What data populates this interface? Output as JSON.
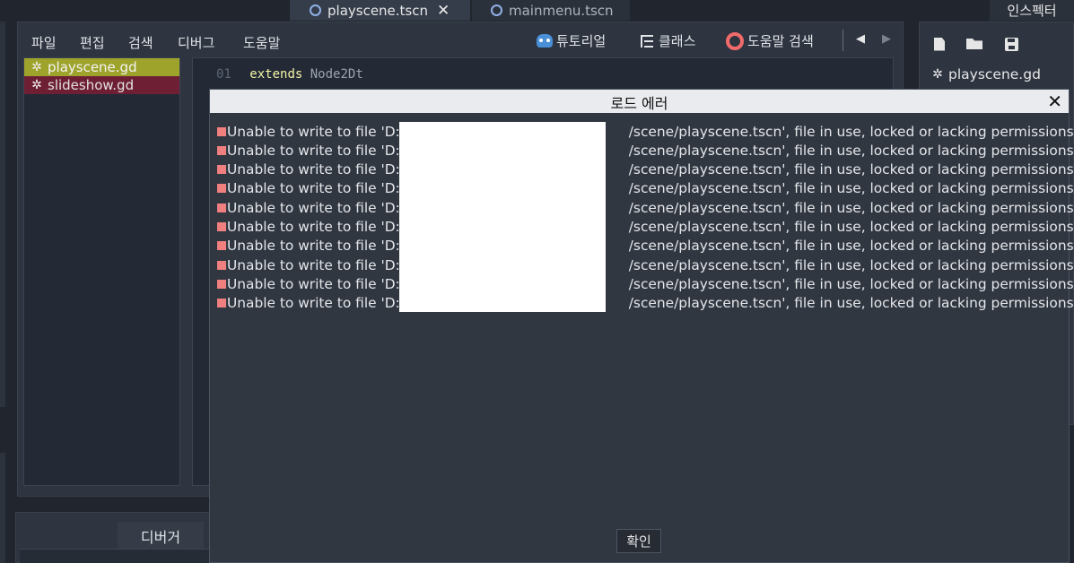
{
  "scene_tabs": [
    {
      "label": "playscene.tscn",
      "close": "✕"
    },
    {
      "label": "mainmenu.tscn"
    }
  ],
  "inspector": {
    "tab_label": "인스펙터",
    "file_label": "playscene.gd"
  },
  "script_menu": {
    "file": "파일",
    "edit": "편집",
    "search": "검색",
    "debug": "디버그",
    "help": "도움말"
  },
  "script_toolbar": {
    "tutorial": "튜토리얼",
    "classes": "클래스",
    "help_search": "도움말 검색",
    "prev": "◀",
    "next": "▶"
  },
  "script_list": [
    {
      "name": "playscene.gd",
      "color": "#9ea32b"
    },
    {
      "name": "slideshow.gd",
      "color": "#6e1f34"
    }
  ],
  "code": {
    "line_number": "01",
    "keyword": "extends",
    "identifier": "Node2Dt"
  },
  "dialog": {
    "title": "로드 에러",
    "close": "✕",
    "error_prefix": "Unable to write to file 'D:",
    "error_suffix": "/scene/playscene.tscn', file in use, locked or lacking permissions.",
    "error_count": 10,
    "ok_label": "확인"
  },
  "bottom_panel": {
    "debugger_tab": "디버거"
  },
  "colors": {
    "error_bullet": "#f07f7f",
    "keyword": "#f5f5a6",
    "line_number": "#5c6675"
  }
}
